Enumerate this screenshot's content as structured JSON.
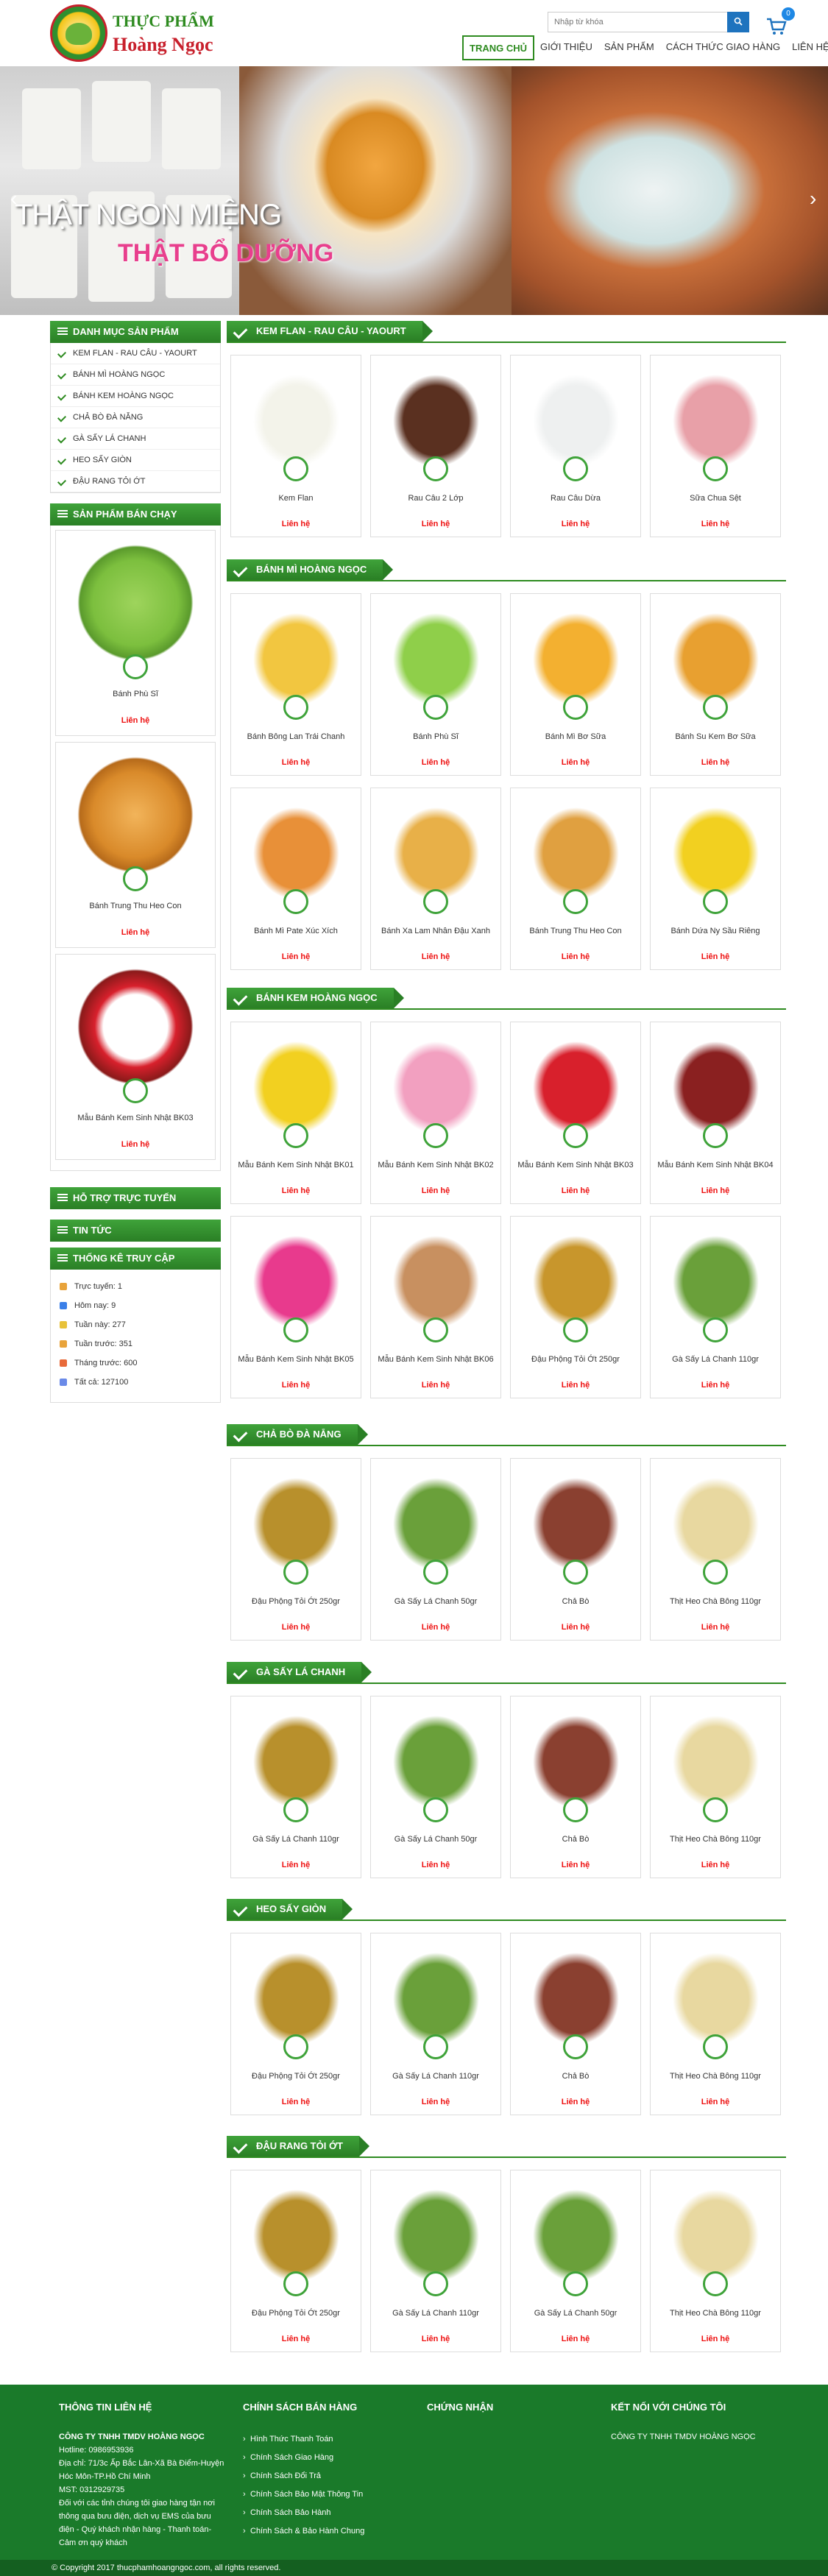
{
  "header": {
    "logo_line1": "THỰC PHẨM",
    "logo_line2": "Hoàng Ngọc",
    "search_placeholder": "Nhập từ khóa",
    "cart_count": "0",
    "nav": [
      "TRANG CHỦ",
      "GIỚI THIỆU",
      "SẢN PHẨM",
      "CÁCH THỨC GIAO HÀNG",
      "LIÊN HỆ"
    ]
  },
  "banner": {
    "line1": "THẬT NGON MIỆNG",
    "line2": "THẬT BỔ DƯỠNG"
  },
  "sidebar": {
    "cat_title": "DANH MỤC SẢN PHẨM",
    "categories": [
      "KEM FLAN - RAU CÂU - YAOURT",
      "BÁNH MÌ HOÀNG NGỌC",
      "BÁNH KEM HOÀNG NGỌC",
      "CHẢ BÒ ĐÀ NẴNG",
      "GÀ SẤY LÁ CHANH",
      "HEO SẤY GIÒN",
      "ĐẬU RANG TỎI ỚT"
    ],
    "best_title": "SẢN PHẨM BÁN CHẠY",
    "best": [
      "Bánh Phù Sĩ",
      "Bánh Trung Thu Heo Con",
      "Mẫu Bánh Kem Sinh Nhật BK03"
    ],
    "contact_label": "Liên hệ",
    "support_title": "HỖ TRỢ TRỰC TUYẾN",
    "news_title": "TIN TỨC",
    "stats_title": "THỐNG KÊ TRUY CẬP",
    "stats": [
      "Trực tuyến: 1",
      "Hôm nay: 9",
      "Tuần này: 277",
      "Tuần trước: 351",
      "Tháng trước: 600",
      "Tất cả: 127100"
    ]
  },
  "sections": [
    {
      "title": "KEM FLAN - RAU CÂU - YAOURT",
      "items": [
        "Kem Flan",
        "Rau Câu 2 Lớp",
        "Rau Câu Dừa",
        "Sữa Chua Sệt"
      ]
    },
    {
      "title": "BÁNH MÌ HOÀNG NGỌC",
      "items": [
        "Bánh Bông Lan Trái Chanh",
        "Bánh Phù Sĩ",
        "Bánh Mì Bơ Sữa",
        "Bánh Su Kem Bơ Sữa",
        "Bánh Mì Pate Xúc Xích",
        "Bánh Xa Lam Nhân Đậu Xanh",
        "Bánh Trung Thu Heo Con",
        "Bánh Dứa Ny Sầu Riêng"
      ]
    },
    {
      "title": "BÁNH KEM HOÀNG NGỌC",
      "items": [
        "Mẫu Bánh Kem Sinh Nhật BK01",
        "Mẫu Bánh Kem Sinh Nhật BK02",
        "Mẫu Bánh Kem Sinh Nhật BK03",
        "Mẫu Bánh Kem Sinh Nhật BK04",
        "Mẫu Bánh Kem Sinh Nhật BK05",
        "Mẫu Bánh Kem Sinh Nhật BK06",
        "Đậu Phộng Tỏi Ớt 250gr",
        "Gà Sấy Lá Chanh 110gr"
      ]
    },
    {
      "title": "CHẢ BÒ ĐÀ NẴNG",
      "items": [
        "Đậu Phộng Tỏi Ớt 250gr",
        "Gà Sấy Lá Chanh 50gr",
        "Chả Bò",
        "Thịt Heo Chà Bông 110gr"
      ]
    },
    {
      "title": "GÀ SẤY LÁ CHANH",
      "items": [
        "Gà Sấy Lá Chanh 110gr",
        "Gà Sấy Lá Chanh 50gr",
        "Chả Bò",
        "Thịt Heo Chà Bông 110gr"
      ]
    },
    {
      "title": "HEO SẤY GIÒN",
      "items": [
        "Đậu Phộng Tỏi Ớt 250gr",
        "Gà Sấy Lá Chanh 110gr",
        "Chả Bò",
        "Thịt Heo Chà Bông 110gr"
      ]
    },
    {
      "title": "ĐẬU RANG TỎI ỚT",
      "items": [
        "Đậu Phộng Tỏi Ớt 250gr",
        "Gà Sấy Lá Chanh 110gr",
        "Gà Sấy Lá Chanh 50gr",
        "Thịt Heo Chà Bông 110gr"
      ]
    }
  ],
  "footer": {
    "col1_title": "THÔNG TIN LIÊN HỆ",
    "company": "CÔNG TY TNHH TMDV HOÀNG NGỌC",
    "info": [
      "Hotline: 0986953936",
      "Địa chỉ: 71/3c Ấp Bắc Lân-Xã Bà Điểm-Huyện Hóc Môn-TP.Hồ Chí Minh",
      "MST: 0312929735",
      "Đối với các tỉnh chúng tôi giao hàng tận nơi thông qua bưu điện, dịch vụ EMS của bưu điện - Quý khách nhận hàng - Thanh toán- Cảm ơn quý khách"
    ],
    "col2_title": "CHÍNH SÁCH BÁN HÀNG",
    "policies": [
      "Hình Thức Thanh Toán",
      "Chính Sách Giao Hàng",
      "Chính Sách Đổi Trả",
      "Chính Sách Bảo Mật Thông Tin",
      "Chính Sách Bảo Hành",
      "Chính Sách & Bảo Hành Chung"
    ],
    "col3_title": "CHỨNG NHẬN",
    "col4_title": "KẾT NỐI VỚI CHÚNG TÔI",
    "col4_text": "CÔNG TY TNHH TMDV HOÀNG NGỌC",
    "copyright": "© Copyright 2017 thucphamhoangngoc.com, all rights reserved."
  },
  "colors": {
    "brand_green": "#2e8b20",
    "accent_red": "#e11111",
    "footer_green": "#1a7a2a"
  }
}
